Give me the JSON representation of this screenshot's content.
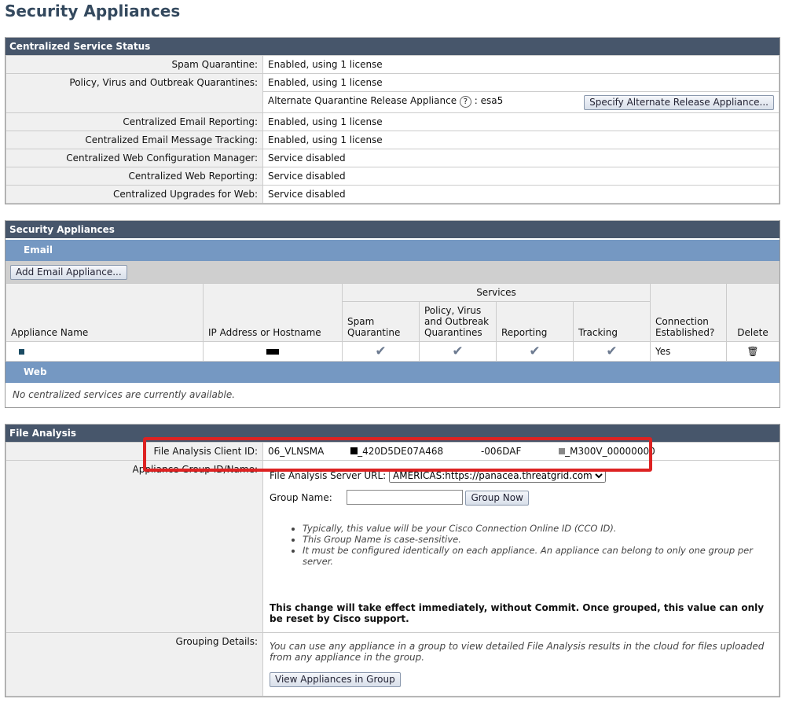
{
  "page_title": "Security Appliances",
  "status": {
    "title": "Centralized Service Status",
    "rows": [
      {
        "label": "Spam Quarantine:",
        "value": "Enabled, using 1 license"
      },
      {
        "label": "Policy, Virus and Outbreak Quarantines:",
        "value": "Enabled, using 1 license"
      },
      {
        "label": "Centralized Email Reporting:",
        "value": "Enabled, using 1 license"
      },
      {
        "label": "Centralized Email Message Tracking:",
        "value": "Enabled, using 1 license"
      },
      {
        "label": "Centralized Web Configuration Manager:",
        "value": "Service disabled"
      },
      {
        "label": "Centralized Web Reporting:",
        "value": "Service disabled"
      },
      {
        "label": "Centralized Upgrades for Web:",
        "value": "Service disabled"
      }
    ],
    "alt_label": "Alternate Quarantine Release Appliance",
    "alt_sep": ": esa5",
    "alt_button": "Specify Alternate Release Appliance..."
  },
  "appliances": {
    "title": "Security Appliances",
    "email_label": "Email",
    "add_button": "Add Email Appliance...",
    "headers": {
      "name": "Appliance Name",
      "ip": "IP Address or Hostname",
      "services": "Services",
      "spam": "Spam Quarantine",
      "policy": "Policy, Virus and Outbreak Quarantines",
      "reporting": "Reporting",
      "tracking": "Tracking",
      "connection": "Connection Established?",
      "delete": "Delete"
    },
    "row": {
      "connection": "Yes"
    },
    "web_label": "Web",
    "web_empty": "No centralized services are currently available."
  },
  "file_analysis": {
    "title": "File Analysis",
    "client_id_label": "File Analysis Client ID:",
    "client_id_parts": [
      "06_VLNSMA",
      "_420D5DE07A468",
      "-006DAF",
      "_M300V_00000000"
    ],
    "group_label": "Appliance Group ID/Name:",
    "server_url_label": "File Analysis Server URL:",
    "server_url_value": "AMERICAS:https://panacea.threatgrid.com",
    "group_name_label": "Group Name:",
    "group_name_value": "",
    "group_now": "Group Now",
    "notes": [
      "Typically, this value will be your Cisco Connection Online ID (CCO ID).",
      "This Group Name is case-sensitive.",
      "It must be configured identically on each appliance. An appliance can belong to only one group per server."
    ],
    "warning": "This change will take effect immediately, without Commit. Once grouped, this value can only be reset by Cisco support.",
    "grouping_label": "Grouping Details:",
    "grouping_text": "You can use any appliance in a group to view detailed File Analysis results in the cloud for files uploaded from any appliance in the group.",
    "view_button": "View Appliances in Group"
  }
}
